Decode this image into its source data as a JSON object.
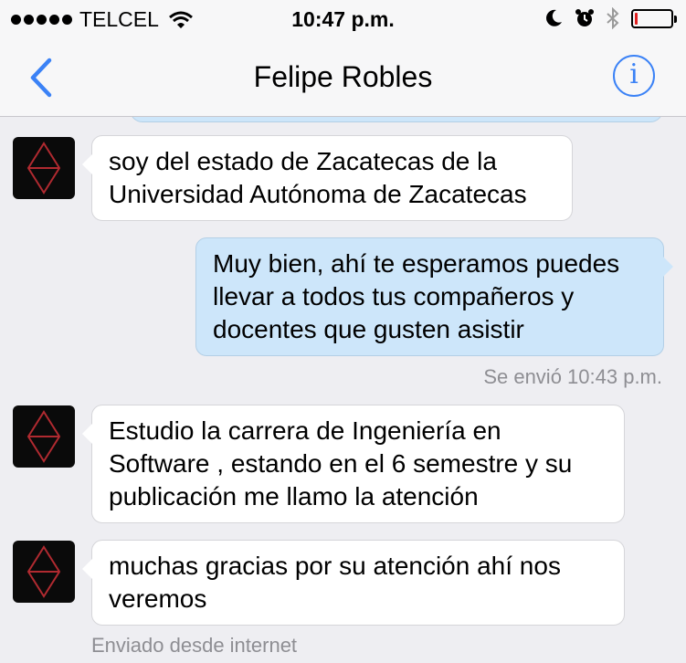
{
  "status_bar": {
    "carrier": "TELCEL",
    "time": "10:47 p.m.",
    "battery_level": 0.08
  },
  "nav": {
    "title": "Felipe Robles",
    "info_glyph": "i"
  },
  "colors": {
    "accent": "#3b82f6",
    "incoming_bubble": "#ffffff",
    "outgoing_bubble": "#cde6fa",
    "battery_low": "#e02020"
  },
  "messages": [
    {
      "direction": "incoming",
      "text": "soy del estado  de Zacatecas de la Universidad Autónoma de Zacatecas"
    },
    {
      "direction": "outgoing",
      "text": "Muy bien, ahí te esperamos puedes llevar a todos tus compañeros y docentes que gusten asistir",
      "status": "Se envió 10:43 p.m."
    },
    {
      "direction": "incoming",
      "text": "Estudio  la carrera de Ingeniería en Software  ,   estando en el 6 semestre y su publicación me llamo la atención"
    },
    {
      "direction": "incoming",
      "text": "muchas gracias por su atención ahí nos veremos"
    }
  ],
  "footer_note": "Enviado desde internet"
}
